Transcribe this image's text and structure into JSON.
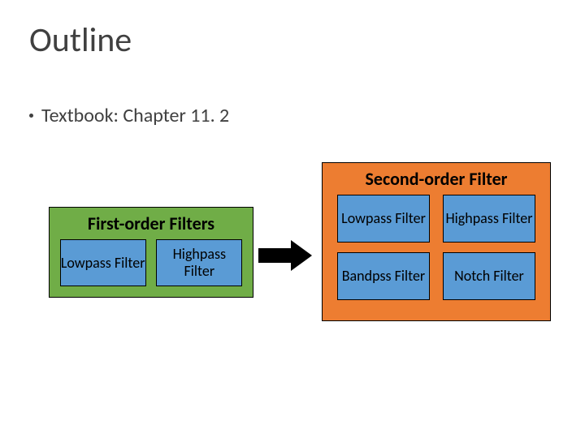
{
  "title": "Outline",
  "bullet": "Textbook: Chapter 11. 2",
  "first": {
    "title": "First-order Filters",
    "items": [
      "Lowpass\nFilter",
      "Highpass\nFilter"
    ]
  },
  "second": {
    "title": "Second-order Filter",
    "items": [
      "Lowpass\nFilter",
      "Highpass\nFilter",
      "Bandpss\nFilter",
      "Notch\nFilter"
    ]
  }
}
